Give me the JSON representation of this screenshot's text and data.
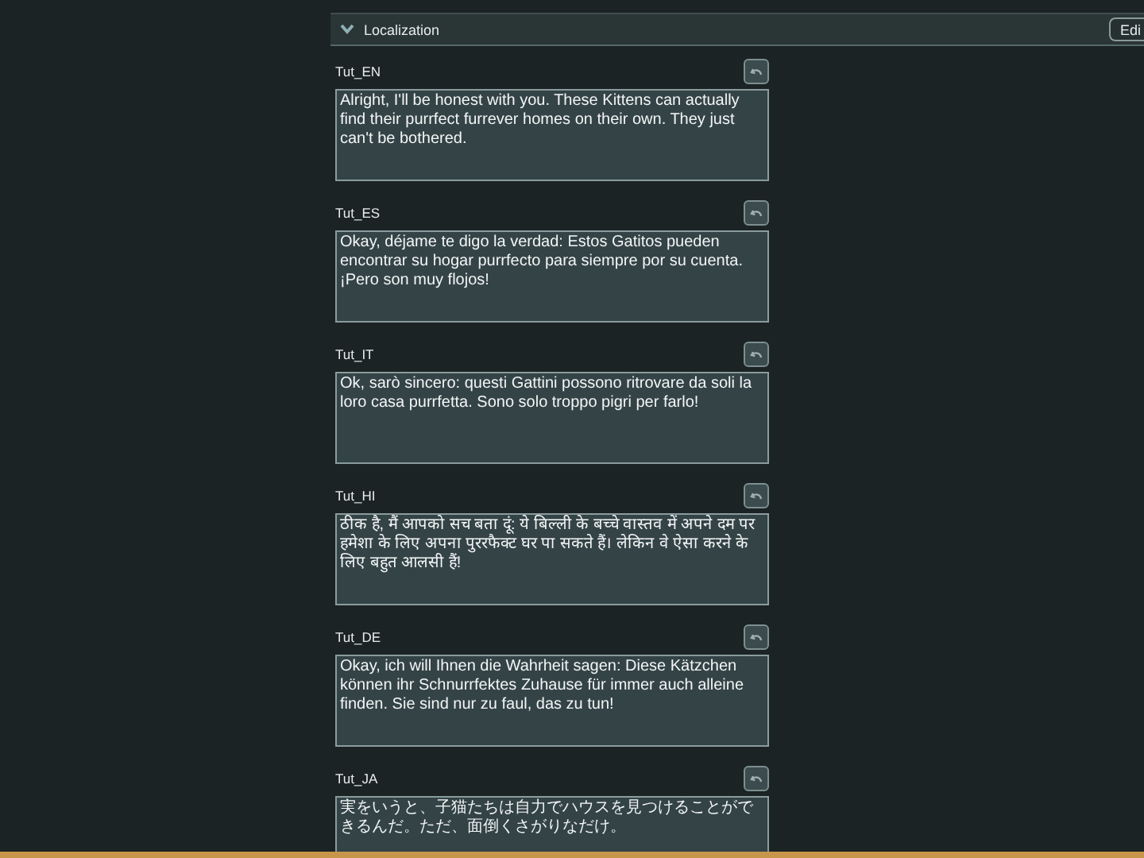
{
  "section": {
    "title": "Localization",
    "expanded": true,
    "edit_button": "Edi"
  },
  "entries": [
    {
      "key": "Tut_EN",
      "value": "Alright, I'll be honest with you. These Kittens can actually find their purrfect furrever homes on their own. They just can't be bothered."
    },
    {
      "key": "Tut_ES",
      "value": "Okay, déjame te digo la verdad: Estos Gatitos pueden encontrar su hogar purrfecto para siempre por su cuenta. ¡Pero son muy flojos!"
    },
    {
      "key": "Tut_IT",
      "value": "Ok, sarò sincero: questi Gattini possono ritrovare da soli la loro casa purrfetta. Sono solo troppo pigri per farlo!"
    },
    {
      "key": "Tut_HI",
      "value": "ठीक है, मैं आपको सच बता दूं: ये बिल्ली के बच्चे वास्तव में अपने दम पर हमेशा के लिए अपना पुररफैक्ट घर पा सकते हैं। लेकिन वे ऐसा करने के लिए बहुत आलसी हैं!"
    },
    {
      "key": "Tut_DE",
      "value": "Okay, ich will Ihnen die Wahrheit sagen: Diese Kätzchen können ihr Schnurrfektes Zuhause für immer auch alleine finden. Sie sind nur zu faul, das zu tun!"
    },
    {
      "key": "Tut_JA",
      "value": "実をいうと、子猫たちは自力でハウスを見つけることができるんだ。ただ、面倒くさがりなだけ。"
    }
  ]
}
